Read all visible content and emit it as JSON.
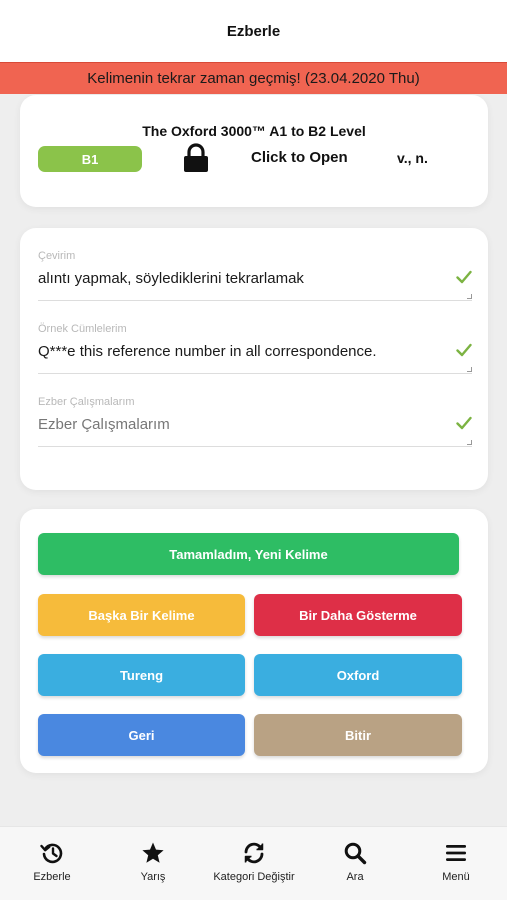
{
  "header": {
    "title": "Ezberle"
  },
  "alert": {
    "text": "Kelimenin tekrar zaman geçmiş! (23.04.2020 Thu)"
  },
  "word_card": {
    "deck_title": "The Oxford 3000™ A1 to B2 Level",
    "level": "B1",
    "open_label": "Click to Open",
    "part_of_speech": "v., n.",
    "lock_icon": "lock-icon"
  },
  "fields": [
    {
      "label": "Çevirim",
      "value": "alıntı yapmak, söylediklerini tekrarlamak",
      "placeholder": ""
    },
    {
      "label": "Örnek Cümlelerim",
      "value": "Q***e this reference number in all correspondence.",
      "placeholder": ""
    },
    {
      "label": "Ezber Çalışmalarım",
      "value": "",
      "placeholder": "Ezber Çalışmalarım"
    }
  ],
  "actions": {
    "complete": "Tamamladım, Yeni Kelime",
    "another": "Başka Bir Kelime",
    "dont_show": "Bir Daha Gösterme",
    "tureng": "Tureng",
    "oxford": "Oxford",
    "back": "Geri",
    "finish": "Bitir"
  },
  "nav": [
    {
      "label": "Ezberle",
      "icon": "history-icon"
    },
    {
      "label": "Yarış",
      "icon": "star-icon"
    },
    {
      "label": "Kategori Değiştir",
      "icon": "sync-icon"
    },
    {
      "label": "Ara",
      "icon": "search-icon"
    },
    {
      "label": "Menü",
      "icon": "menu-icon"
    }
  ],
  "colors": {
    "alert": "#f06451",
    "level_badge": "#8bc34a",
    "check": "#7cb342",
    "complete": "#2ebd64",
    "another": "#f6bb3b",
    "dont_show": "#de2f47",
    "tureng": "#3aaee0",
    "oxford": "#3aaee0",
    "back": "#4a88e0",
    "finish": "#b9a284"
  }
}
